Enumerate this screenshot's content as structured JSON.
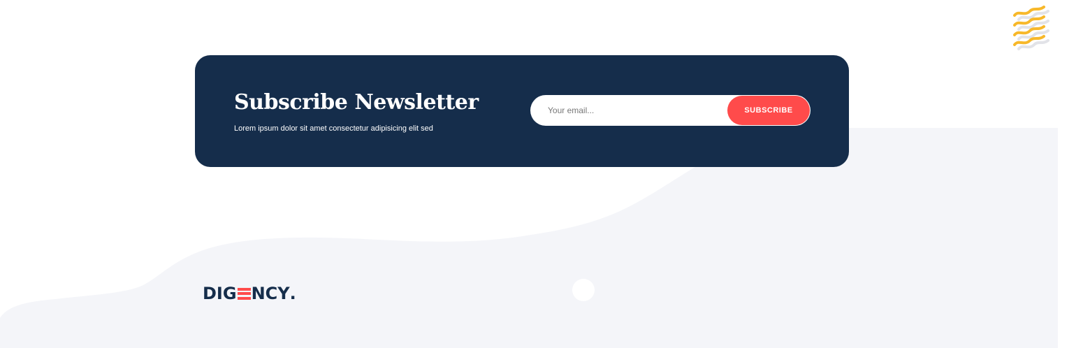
{
  "newsletter": {
    "title": "Subscribe Newsletter",
    "subtitle": "Lorem ipsum dolor sit amet consectetur adipisicing elit sed",
    "email_placeholder": "Your email...",
    "subscribe_label": "SUBSCRIBE"
  },
  "footer": {
    "logo_part1": "DIG",
    "logo_part2": "NCY",
    "logo_dot": "."
  },
  "colors": {
    "navy": "#152d4b",
    "accent": "#ff4b4b",
    "background_shape": "#f4f5f9",
    "squiggle": "#f7b82a"
  },
  "icons": {
    "decoration": "squiggle-icon"
  }
}
